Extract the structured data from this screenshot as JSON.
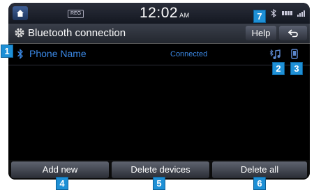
{
  "status_bar": {
    "reg_badge": "REG",
    "time": "12:02",
    "ampm": "AM"
  },
  "header": {
    "title": "Bluetooth connection",
    "help_label": "Help"
  },
  "device": {
    "name": "Phone Name",
    "status": "Connected"
  },
  "bottom_buttons": {
    "add_new": "Add new",
    "delete_devices": "Delete devices",
    "delete_all": "Delete all"
  },
  "callouts": [
    "1",
    "2",
    "3",
    "4",
    "5",
    "6",
    "7"
  ],
  "colors": {
    "accent_blue": "#3b89e6",
    "callout_blue": "#1e90d6"
  }
}
